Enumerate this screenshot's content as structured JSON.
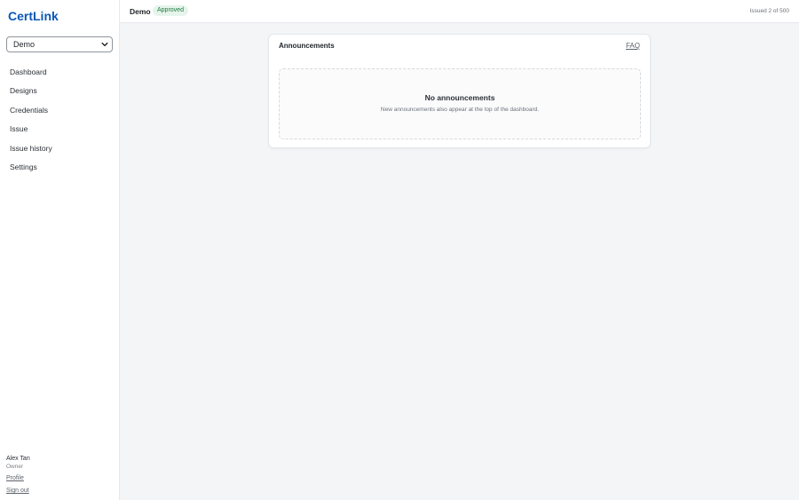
{
  "app": {
    "brand": "CertLink"
  },
  "sidebar": {
    "org_select": {
      "selected": "Demo"
    },
    "items": [
      {
        "label": "Dashboard"
      },
      {
        "label": "Designs"
      },
      {
        "label": "Credentials"
      },
      {
        "label": "Issue"
      },
      {
        "label": "Issue history"
      },
      {
        "label": "Settings"
      }
    ],
    "user": {
      "name": "Alex Tan",
      "role": "Owner",
      "profile_label": "Profile",
      "signout_label": "Sign out"
    }
  },
  "header": {
    "org_name": "Demo",
    "status": "Approved",
    "usage": "Issued 2 of 500"
  },
  "announcements": {
    "title": "Announcements",
    "faq_label": "FAQ",
    "empty_title": "No announcements",
    "empty_description": "New announcements also appear at the top of the dashboard."
  },
  "colors": {
    "brand": "#0b57b7",
    "status_bg": "#e6f5ec",
    "status_text": "#1e7a3e",
    "page_bg": "#f4f5f7"
  },
  "icons": {
    "org_select_caret": "chevron-down-icon"
  }
}
